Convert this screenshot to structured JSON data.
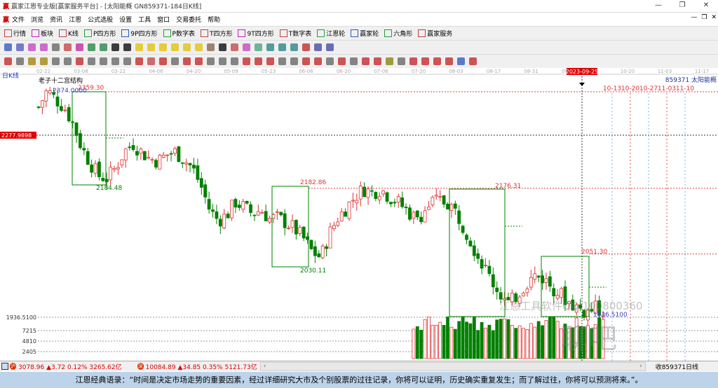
{
  "window": {
    "title": "赢家江恩专业版[赢家服务平台] - [太阳能概  GN859371-184日K线]",
    "logo": "赢",
    "min": "—",
    "max": "❐",
    "close": "✕"
  },
  "menu": [
    "文件",
    "浏览",
    "资讯",
    "江恩",
    "公式选股",
    "设置",
    "工具",
    "窗口",
    "交易委托",
    "帮助"
  ],
  "mdi": [
    "—",
    "❐",
    "✕"
  ],
  "toolbar1": [
    {
      "icon": "grid-icon",
      "label": "行情"
    },
    {
      "icon": "blocks-icon",
      "label": "板块"
    },
    {
      "icon": "candles-icon",
      "label": "K线"
    },
    {
      "icon": "P8",
      "label": "P四方形"
    },
    {
      "icon": "P9",
      "label": "9P四方形"
    },
    {
      "icon": "PN",
      "label": "P数字表"
    },
    {
      "icon": "T8",
      "label": "T四方形"
    },
    {
      "icon": "T9",
      "label": "9T四方形"
    },
    {
      "icon": "TN",
      "label": "T数字表"
    },
    {
      "icon": "wheel-icon",
      "label": "江恩轮"
    },
    {
      "icon": "wheel-icon",
      "label": "赢家轮"
    },
    {
      "icon": "hexagon-icon",
      "label": "六角形"
    },
    {
      "icon": "dollar-icon",
      "label": "赢家服务"
    }
  ],
  "toolbar2_colors": [
    "#3050c0",
    "#5050c0",
    "#c040c0",
    "#c040c0",
    "#606060",
    "#c04040",
    "#c020a0",
    "#208040",
    "#208040",
    "#000",
    "#000",
    "#e0c000",
    "#e0c000",
    "#e0c000",
    "#e0c000",
    "#e0c000",
    "#e0c000",
    "#806040",
    "#000",
    "#c04040",
    "#c040c0",
    "#40a080",
    "#208080",
    "#208080",
    "#208080",
    "#c02020",
    "#4040a0",
    "#4040a0"
  ],
  "toolbar3_colors": [
    "#c02020",
    "#606060",
    "#a08000",
    "#a08000",
    "#606060",
    "#606060",
    "#c02020",
    "#606060",
    "#606060",
    "#606060",
    "#606060",
    "#c02020",
    "#c04040",
    "#c02020",
    "#606060",
    "#c02020",
    "#c02020",
    "#606060",
    "#606060",
    "#606060",
    "#c02020",
    "#c02020",
    "#c02020",
    "#606060",
    "#606060",
    "#c02020",
    "#c02020",
    "#606060",
    "#c02020",
    "#606060",
    "#c02020",
    "#c02020",
    "#808000",
    "#606060",
    "#c02020",
    "#c02020",
    "#c02020",
    "#c02020",
    "#3050c0",
    "#c02020"
  ],
  "chart": {
    "period_label": "日K线",
    "structure_label": "老子十二宫结构",
    "code_label": "859371  太阳能概",
    "date_ticks": [
      "02-22",
      "03-08",
      "03-22",
      "04-06",
      "04-20",
      "05-09",
      "05-23",
      "06-06",
      "06-20",
      "07-06",
      "07-20",
      "08-03",
      "08-17",
      "08-31",
      "09-14",
      "10-20",
      "11-03",
      "11-17"
    ],
    "cursor_date": "2023-09-25",
    "future_dates": [
      "10-13",
      "10-20",
      "10-27",
      "11-03",
      "11-10"
    ],
    "cursor_price": "2277.9898",
    "axis_labels": [
      "1936.5100",
      "7215",
      "4810",
      "2405"
    ],
    "labels": {
      "high_start": "2374.0000",
      "box1_top": "2359.30",
      "box1_bottom": "2184.48",
      "box2_top": "2182.86",
      "box2_bottom": "2030.11",
      "box3_top": "2176.31",
      "box4_top": "2051.30",
      "low": "1936.5100"
    },
    "watermark": "江恩工具软件QQ:100800360",
    "watermark2": "聊吧",
    "price_path": [
      2330,
      2362,
      2345,
      2330,
      2300,
      2255,
      2225,
      2200,
      2195,
      2215,
      2245,
      2262,
      2245,
      2232,
      2228,
      2240,
      2245,
      2230,
      2215,
      2180,
      2135,
      2115,
      2125,
      2150,
      2140,
      2128,
      2135,
      2118,
      2120,
      2110,
      2098,
      2080,
      2055,
      2045,
      2090,
      2120,
      2140,
      2160,
      2175,
      2168,
      2175,
      2160,
      2150,
      2135,
      2120,
      2130,
      2150,
      2152,
      2148,
      2125,
      2095,
      2060,
      2030,
      2000,
      1975,
      1955,
      1975,
      1995,
      2010,
      2005,
      1990,
      1975,
      1960,
      1950,
      1940,
      1948,
      1945
    ]
  },
  "status": {
    "sh_value": "3078.96",
    "sh_change": "▲3.72",
    "sh_pct": "0.12%",
    "sh_amount": "3265.62亿",
    "sz_value": "10084.89",
    "sz_change": "▲34.85",
    "sz_pct": "0.35%",
    "sz_amount": "5121.73亿",
    "sh_badge": "沪",
    "sz_badge": "深",
    "right": "收859371日线"
  },
  "quote": "江恩经典语录：“时间是决定市场走势的重要因素，经过详细研究大市及个别股票的过往记录，你将可以证明，历史确实重复发生；而了解过往，你将可以预测将来。”。"
}
